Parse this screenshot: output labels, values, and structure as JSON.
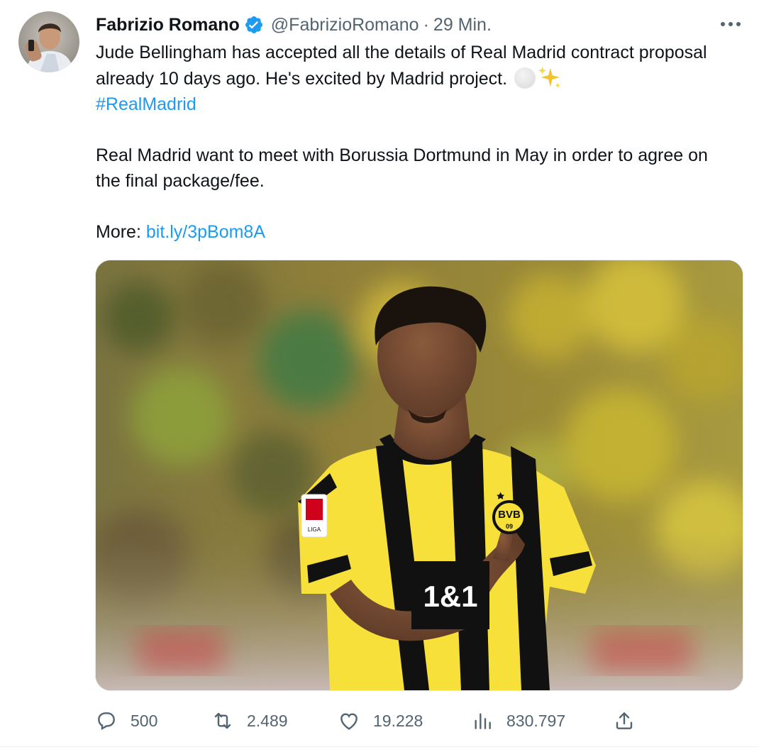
{
  "author": {
    "name": "Fabrizio Romano",
    "handle": "@FabrizioRomano",
    "separator": "·",
    "time": "29 Min.",
    "verified": true
  },
  "tweet": {
    "line1": "Jude Bellingham has accepted all the details of Real Madrid contract proposal already 10 days ago. He's excited by Madrid project.",
    "hashtag": "#RealMadrid",
    "paragraph2": "Real Madrid want to meet with Borussia Dortmund in May in order to agree on the final package/fee.",
    "more_label": "More:",
    "more_link": "bit.ly/3pBom8A"
  },
  "media": {
    "shirt_sponsor": "1&1",
    "crest_text": "BVB",
    "crest_year": "09",
    "sleeve_badge": "LIGA"
  },
  "actions": {
    "replies": "500",
    "retweets": "2.489",
    "likes": "19.228",
    "views": "830.797"
  },
  "colors": {
    "link": "#1d9bf0",
    "muted": "#536471",
    "verified": "#1d9bf0",
    "jersey_yellow": "#f7e03a",
    "jersey_black": "#111111"
  }
}
